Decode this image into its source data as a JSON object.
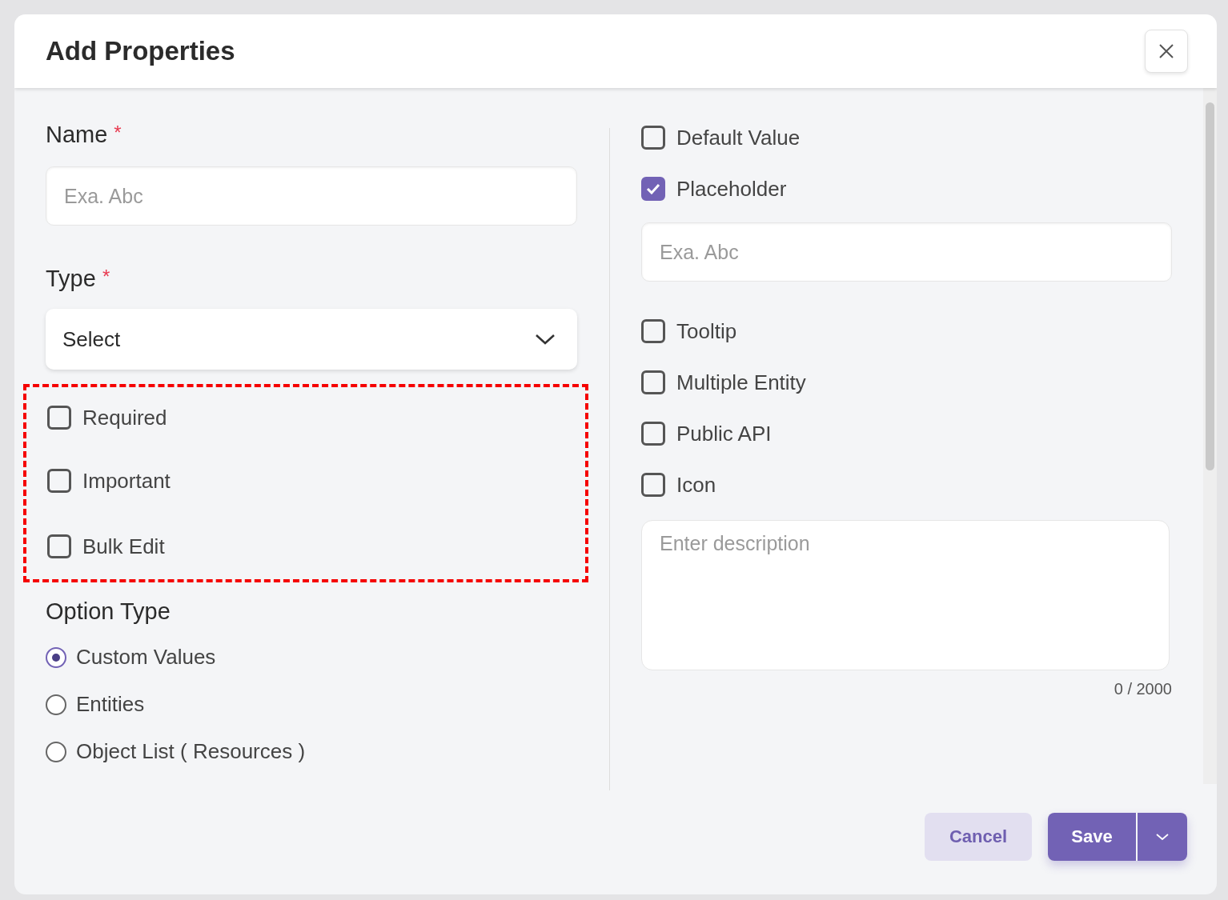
{
  "dialog": {
    "title": "Add Properties"
  },
  "name_field": {
    "label": "Name",
    "required_mark": "*",
    "placeholder": "Exa. Abc"
  },
  "type_field": {
    "label": "Type",
    "required_mark": "*",
    "value": "Select"
  },
  "flags": [
    {
      "label": "Required",
      "checked": false
    },
    {
      "label": "Important",
      "checked": false
    },
    {
      "label": "Bulk Edit",
      "checked": false
    }
  ],
  "option_type": {
    "label": "Option Type",
    "options": [
      {
        "label": "Custom Values",
        "selected": true
      },
      {
        "label": "Entities",
        "selected": false
      },
      {
        "label": "Object List ( Resources )",
        "selected": false
      }
    ]
  },
  "right_options": [
    {
      "kind": "checkbox",
      "label": "Default Value",
      "checked": false
    },
    {
      "kind": "checkbox",
      "label": "Placeholder",
      "checked": true
    },
    {
      "kind": "input",
      "placeholder": "Exa. Abc"
    },
    {
      "kind": "checkbox",
      "label": "Tooltip",
      "checked": false
    },
    {
      "kind": "checkbox",
      "label": "Multiple Entity",
      "checked": false
    },
    {
      "kind": "checkbox",
      "label": "Public API",
      "checked": false
    },
    {
      "kind": "checkbox",
      "label": "Icon",
      "checked": false
    }
  ],
  "description": {
    "placeholder": "Enter description",
    "counter": "0 / 2000"
  },
  "buttons": {
    "cancel": "Cancel",
    "save": "Save"
  }
}
